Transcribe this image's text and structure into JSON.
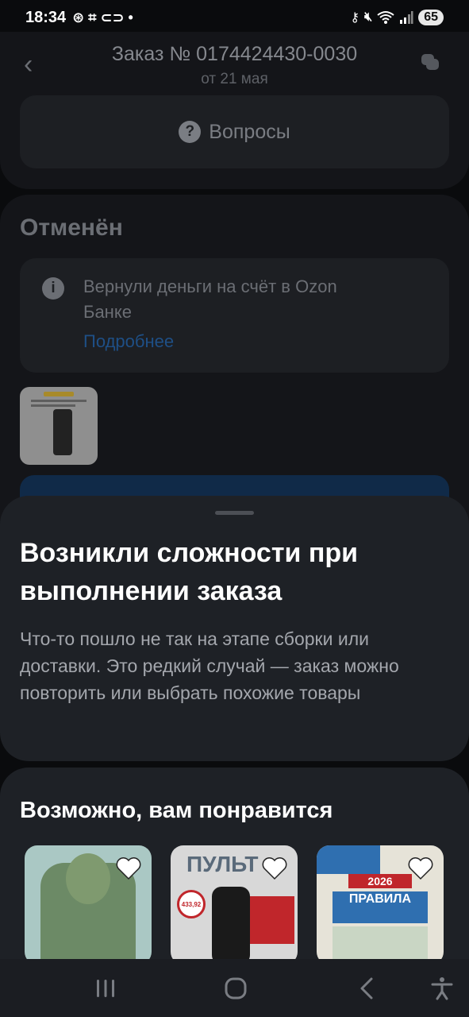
{
  "status_bar": {
    "time": "18:34",
    "battery": "65",
    "icons": [
      "vpn-key-icon",
      "mute-icon",
      "wifi-icon",
      "signal-icon",
      "battery-icon"
    ]
  },
  "header": {
    "title": "Заказ № 0174424430-0030",
    "subtitle": "от 21 мая"
  },
  "questions_button": {
    "label": "Вопросы"
  },
  "order_status": {
    "title": "Отменён",
    "refund_text": "Вернули деньги на счёт в Ozon Банке",
    "refund_link": "Подробнее"
  },
  "sheet": {
    "title": "Возникли сложности при выполнении заказа",
    "description": "Что-то пошло не так на этапе сборки или доставки. Это редкий случай — заказ можно повторить или выбрать похожие товары"
  },
  "recommendations": {
    "title": "Возможно, вам понравится"
  },
  "colors": {
    "background": "#0a0b0d",
    "sheet": "#1e2126",
    "link": "#1e4f86",
    "secondary_text": "#a4a7ad"
  }
}
